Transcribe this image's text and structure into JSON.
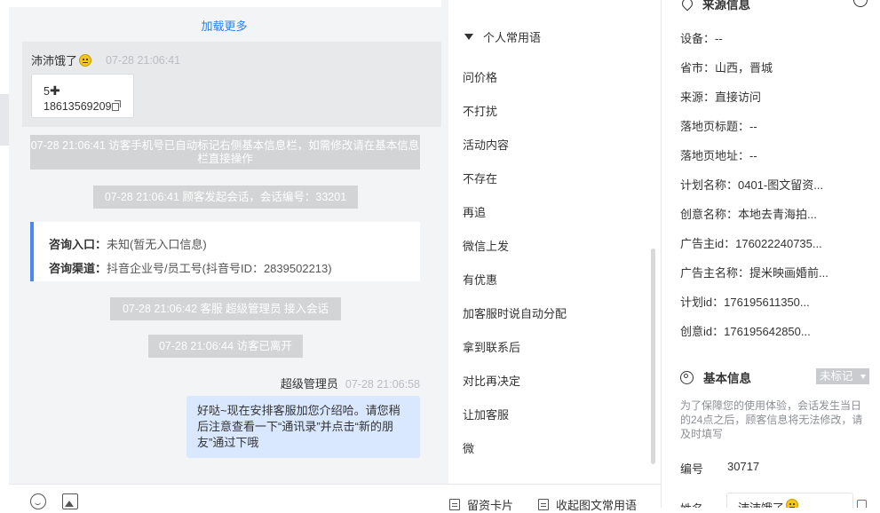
{
  "chat": {
    "load_more": "加载更多",
    "visitor_message": {
      "sender": "沛沛饿了",
      "time": "07-28 21:06:41",
      "card_line1": "5",
      "card_line2": "18613569209"
    },
    "system_messages": [
      "07-28 21:06:41 访客手机号已自动标记右侧基本信息栏，如需修改请在基本信息栏直接操作",
      "07-28 21:06:41 顾客发起会话，会话编号：33201",
      "07-28 21:06:42 客服 超级管理员 接入会话",
      "07-28 21:06:44 访客已离开"
    ],
    "inquiry": {
      "entry_label": "咨询入口：",
      "entry_value": "未知(暂无入口信息)",
      "channel_label": "咨询渠道：",
      "channel_value": "抖音企业号/员工号(抖音号ID：2839502213)"
    },
    "agent_message": {
      "sender": "超级管理员",
      "time": "07-28 21:06:58",
      "text": "好哒~现在安排客服加您介绍哈。请您稍后注意查看一下“通讯录”并点击“新的朋友”通过下哦"
    }
  },
  "toolbar": {
    "leave_card_label": "留资卡片",
    "collapse_label": "收起图文常用语"
  },
  "phrases": {
    "group_title": "个人常用语",
    "items": [
      "问价格",
      "不打扰",
      "活动内容",
      "不存在",
      "再追",
      "微信上发",
      "有优惠",
      "加客服时说自动分配",
      "拿到联系后",
      "对比再决定",
      "让加客服",
      "微"
    ]
  },
  "source_info": {
    "title": "来源信息",
    "rows": [
      "设备：--",
      "省市：山西，晋城",
      "来源：直接访问",
      "落地页标题：--",
      "落地页地址：--",
      "计划名称：0401-图文留资...",
      "创意名称：本地去青海拍...",
      "广告主id：176022240735...",
      "广告主名称：提米映画婚前...",
      "计划id：176195611350...",
      "创意id：176195642850..."
    ]
  },
  "basic_info": {
    "title": "基本信息",
    "badge": "未标记",
    "notice": "为了保障您的使用体验，会话发生当日的24点之后，顾客信息将无法修改，请及时填写",
    "id_label": "编号",
    "id_value": "30717",
    "name_label": "姓名",
    "name_value": "沛沛饿了"
  }
}
